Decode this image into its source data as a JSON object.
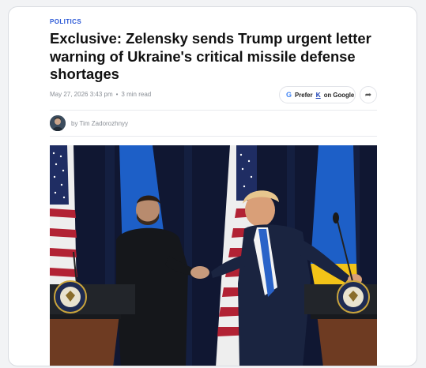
{
  "article": {
    "category": "POLITICS",
    "headline": "Exclusive: Zelensky sends Trump urgent letter warning of Ukraine's critical missile defense shortages",
    "date": "May 27, 2026 3:43 pm",
    "separator": "•",
    "read_time": "3 min read",
    "byline": "by Tim Zadorozhnyy"
  },
  "actions": {
    "prefer_prefix": "Prefer",
    "prefer_suffix": "on Google",
    "google_icon": "google-g-icon",
    "brand_icon": "kyiv-independent-logo-icon",
    "share_icon": "share-arrow-icon"
  },
  "colors": {
    "category": "#2a58d6",
    "headline": "#111111",
    "meta": "#8a8f96",
    "photo_bg": "#0f1426"
  }
}
